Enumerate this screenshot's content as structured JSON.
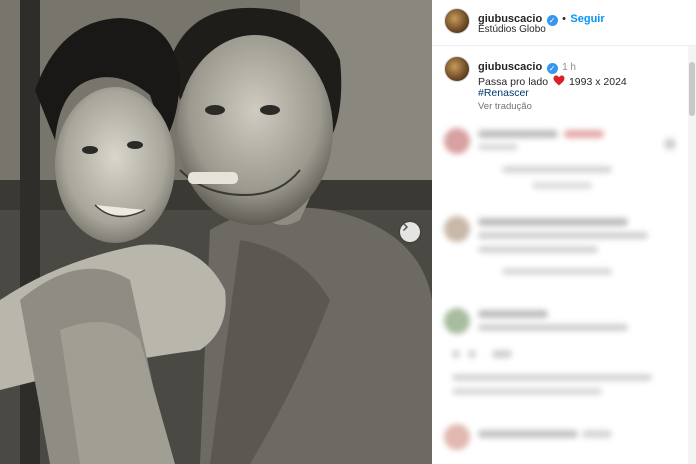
{
  "post": {
    "username": "giubuscacio",
    "follow_label": "Seguir",
    "location": "Estúdios Globo",
    "time": "1 h",
    "caption_before": "Passa pro lado",
    "caption_after": "1993 x 2024",
    "hashtag": "#Renascer",
    "translate_label": "Ver tradução"
  },
  "colors": {
    "link_blue": "#0095f6",
    "verified_blue": "#3797f0",
    "heart_red": "#d8222a"
  },
  "icons": {
    "verified": "verified-badge-icon",
    "heart": "red-heart-icon",
    "carousel_next": "chevron-right-icon"
  }
}
